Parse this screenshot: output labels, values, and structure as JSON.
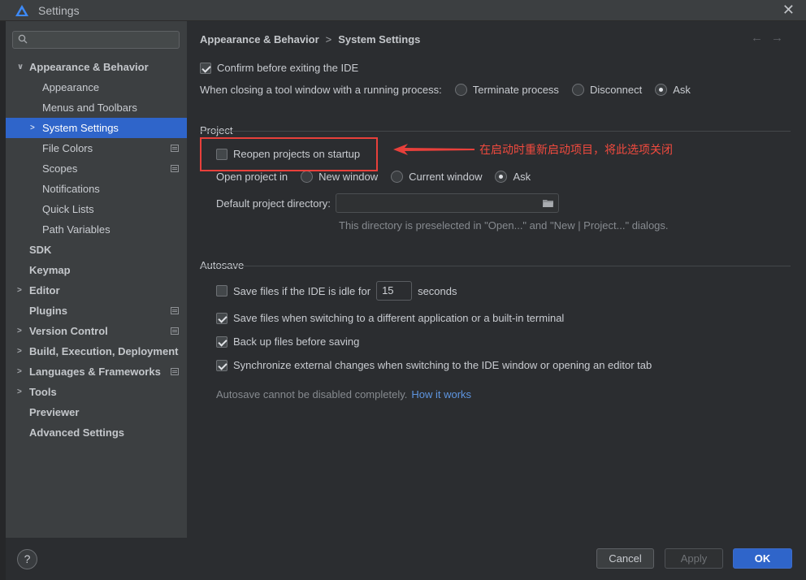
{
  "window": {
    "title": "Settings",
    "close_glyph": "✕"
  },
  "search": {
    "placeholder": ""
  },
  "sidebar": {
    "items": [
      {
        "label": "Appearance & Behavior",
        "arrow": "∨",
        "bold": true,
        "level": 0
      },
      {
        "label": "Appearance",
        "level": 1
      },
      {
        "label": "Menus and Toolbars",
        "level": 1
      },
      {
        "label": "System Settings",
        "arrow": ">",
        "level": 1,
        "selected": true
      },
      {
        "label": "File Colors",
        "level": 1,
        "project_icon": true
      },
      {
        "label": "Scopes",
        "level": 1,
        "project_icon": true
      },
      {
        "label": "Notifications",
        "level": 1
      },
      {
        "label": "Quick Lists",
        "level": 1
      },
      {
        "label": "Path Variables",
        "level": 1
      },
      {
        "label": "SDK",
        "bold": true,
        "level": 0
      },
      {
        "label": "Keymap",
        "bold": true,
        "level": 0
      },
      {
        "label": "Editor",
        "arrow": ">",
        "bold": true,
        "level": 0
      },
      {
        "label": "Plugins",
        "bold": true,
        "level": 0,
        "project_icon": true
      },
      {
        "label": "Version Control",
        "arrow": ">",
        "bold": true,
        "level": 0,
        "project_icon": true
      },
      {
        "label": "Build, Execution, Deployment",
        "arrow": ">",
        "bold": true,
        "level": 0
      },
      {
        "label": "Languages & Frameworks",
        "arrow": ">",
        "bold": true,
        "level": 0,
        "project_icon": true
      },
      {
        "label": "Tools",
        "arrow": ">",
        "bold": true,
        "level": 0
      },
      {
        "label": "Previewer",
        "bold": true,
        "level": 0
      },
      {
        "label": "Advanced Settings",
        "bold": true,
        "level": 0
      }
    ]
  },
  "breadcrumb": {
    "parent": "Appearance & Behavior",
    "sep": ">",
    "current": "System Settings"
  },
  "nav": {
    "back": "←",
    "forward": "→"
  },
  "general": {
    "confirm_exit": {
      "label": "Confirm before exiting the IDE",
      "checked": true
    },
    "closing_tool_window": {
      "label": "When closing a tool window with a running process:",
      "options": [
        "Terminate process",
        "Disconnect",
        "Ask"
      ],
      "selected": "Ask"
    }
  },
  "project": {
    "title": "Project",
    "reopen": {
      "label": "Reopen projects on startup",
      "checked": false
    },
    "open_in": {
      "label": "Open project in",
      "options": [
        "New window",
        "Current window",
        "Ask"
      ],
      "selected": "Ask"
    },
    "default_dir": {
      "label": "Default project directory:",
      "value": ""
    },
    "hint": "This directory is preselected in \"Open...\" and \"New | Project...\" dialogs."
  },
  "annotation": {
    "text": "在启动时重新启动项目，将此选项关闭",
    "color": "#e8403b"
  },
  "autosave": {
    "title": "Autosave",
    "idle": {
      "label_before": "Save files if the IDE is idle for",
      "value": "15",
      "label_after": "seconds",
      "checked": false
    },
    "switch_app": {
      "label": "Save files when switching to a different application or a built-in terminal",
      "checked": true
    },
    "backup": {
      "label": "Back up files before saving",
      "checked": true
    },
    "sync": {
      "label": "Synchronize external changes when switching to the IDE window or opening an editor tab",
      "checked": true
    },
    "note": "Autosave cannot be disabled completely.",
    "link": "How it works"
  },
  "footer": {
    "help": "?",
    "cancel": "Cancel",
    "apply": "Apply",
    "ok": "OK"
  },
  "colors": {
    "accent": "#2f65ca",
    "link": "#5e95e0",
    "annotation": "#e8403b"
  }
}
